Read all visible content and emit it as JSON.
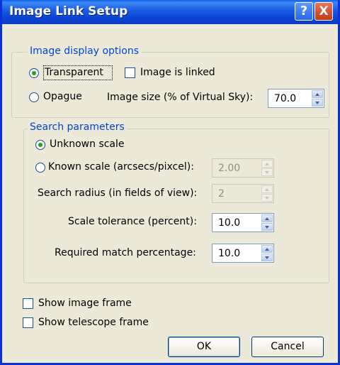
{
  "window": {
    "title": "Image Link Setup",
    "help_glyph": "?",
    "close_glyph": "X"
  },
  "display_options": {
    "legend": "Image display options",
    "transparent": {
      "label": "Transparent",
      "checked": true
    },
    "image_linked": {
      "label": "Image is linked",
      "checked": false
    },
    "opaque": {
      "label": "Opague",
      "checked": false
    },
    "image_size": {
      "label": "Image size (% of Virtual Sky):",
      "value": "70.0"
    }
  },
  "search": {
    "legend": "Search parameters",
    "unknown_scale": {
      "label": "Unknown scale",
      "checked": true
    },
    "known_scale": {
      "label": "Known scale (arcsecs/pixcel):",
      "checked": false,
      "value": "2.00",
      "enabled": false
    },
    "search_radius": {
      "label": "Search radius (in fields of view):",
      "value": "2",
      "enabled": false
    },
    "scale_tolerance": {
      "label": "Scale tolerance (percent):",
      "value": "10.0"
    },
    "match_percentage": {
      "label": "Required match percentage:",
      "value": "10.0"
    }
  },
  "frames": {
    "image_frame": {
      "label": "Show image frame",
      "checked": false
    },
    "telescope_frame": {
      "label": "Show telescope frame",
      "checked": false
    }
  },
  "buttons": {
    "ok": "OK",
    "cancel": "Cancel"
  },
  "colors": {
    "title_bar": "#0a46d6",
    "group_legend": "#0046d5",
    "dialog_bg": "#ece9d8"
  }
}
